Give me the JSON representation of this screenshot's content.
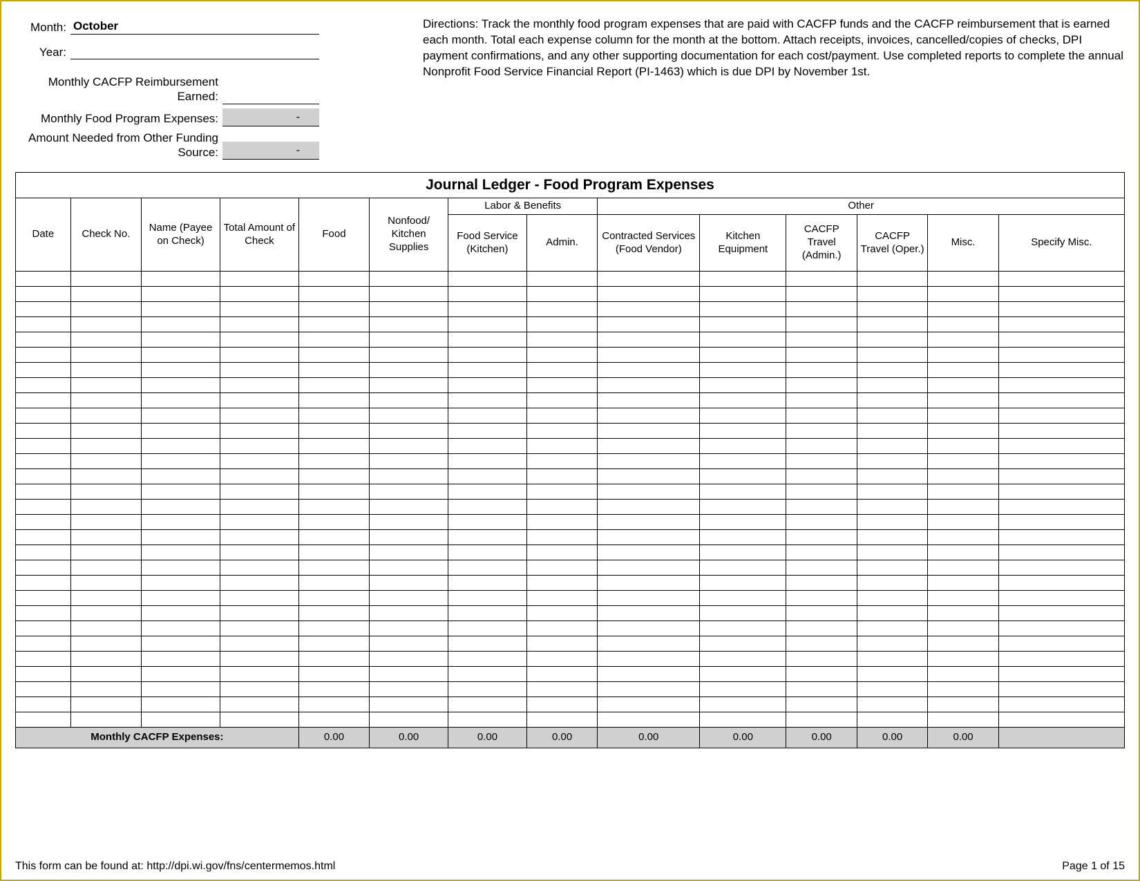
{
  "header": {
    "month_label": "Month:",
    "month_value": "October",
    "year_label": "Year:",
    "year_value": "",
    "reimbursement_label": "Monthly CACFP Reimbursement Earned:",
    "reimbursement_value": "",
    "expenses_label": "Monthly Food Program Expenses:",
    "expenses_value": "-",
    "funding_label": "Amount Needed from Other Funding Source:",
    "funding_value": "-"
  },
  "directions": "Directions: Track the monthly food program expenses that are paid with CACFP funds and the CACFP reimbursement that is earned each month. Total each expense column for the month at the bottom. Attach receipts, invoices, cancelled/copies of checks, DPI payment confirmations, and any other supporting documentation for each cost/payment. Use completed reports to complete  the annual Nonprofit Food Service Financial Report (PI-1463) which is due DPI by November 1st.",
  "ledger": {
    "title": "Journal Ledger - Food Program Expenses",
    "group_labor": "Labor & Benefits",
    "group_other": "Other",
    "columns": {
      "date": "Date",
      "check_no": "Check No.",
      "name": "Name (Payee on Check)",
      "total_amount": "Total Amount of Check",
      "food": "Food",
      "nonfood": "Nonfood/ Kitchen Supplies",
      "food_service": "Food Service (Kitchen)",
      "admin": "Admin.",
      "contracted": "Contracted Services (Food Vendor)",
      "kitchen_equip": "Kitchen Equipment",
      "travel_admin": "CACFP Travel (Admin.)",
      "travel_oper": "CACFP Travel (Oper.)",
      "misc": "Misc.",
      "specify_misc": "Specify Misc."
    },
    "totals": {
      "label": "Monthly CACFP Expenses:",
      "food": "0.00",
      "nonfood": "0.00",
      "food_service": "0.00",
      "admin": "0.00",
      "contracted": "0.00",
      "kitchen_equip": "0.00",
      "travel_admin": "0.00",
      "travel_oper": "0.00",
      "misc": "0.00"
    }
  },
  "footer": {
    "left": "This form can be found at: http://dpi.wi.gov/fns/centermemos.html",
    "right": "Page 1 of 15"
  }
}
